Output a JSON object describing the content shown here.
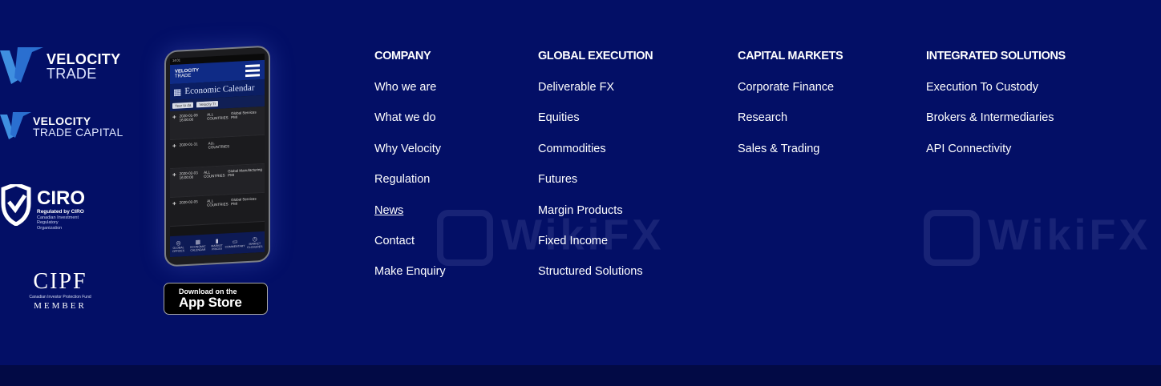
{
  "brand": {
    "velocity_trade": {
      "line1": "VELOCITY",
      "line2": "TRADE"
    },
    "velocity_trade_capital": {
      "line1": "VELOCITY",
      "line2": "TRADE CAPITAL"
    },
    "ciro": {
      "name": "CIRO",
      "regulated": "Regulated by CIRO",
      "org_line1": "Canadian Investment",
      "org_line2": "Regulatory",
      "org_line3": "Organization"
    },
    "cipf": {
      "title": "CIPF",
      "subtitle": "Canadian Investor Protection Fund",
      "member": "MEMBER"
    }
  },
  "phone": {
    "status": "14:01",
    "logo_line1": "VELOCITY",
    "logo_line2": "TRADE",
    "screen_title": "Economic Calendar",
    "filter1": "Year to da",
    "filter2": "Velocity Tr",
    "rows": [
      {
        "date": "2020-01-06 16:00:00",
        "country": "ALL COUNTRIES",
        "event": "Global Services PMI"
      },
      {
        "date": "2020-01-31",
        "country": "ALL COUNTRIES",
        "event": ""
      },
      {
        "date": "2020-02-03 16:00:00",
        "country": "ALL COUNTRIES",
        "event": "Global Manufacturing PMI"
      },
      {
        "date": "2020-02-05",
        "country": "ALL COUNTRIES",
        "event": "Global Services PMI"
      }
    ],
    "nav": [
      "GLOBAL OFFICES",
      "ECONOMIC CALENDAR",
      "MARKET PRICES",
      "COMMENTARY",
      "MARKET CLOSURES"
    ]
  },
  "appstore": {
    "small": "Download on the",
    "big": "App Store"
  },
  "columns": [
    {
      "heading": "COMPANY",
      "links": [
        "Who we are",
        "What we do",
        "Why Velocity",
        "Regulation",
        "News",
        "Contact",
        "Make Enquiry"
      ]
    },
    {
      "heading": "GLOBAL EXECUTION",
      "links": [
        "Deliverable FX",
        "Equities",
        "Commodities",
        "Futures",
        "Margin Products",
        "Fixed Income",
        "Structured Solutions"
      ]
    },
    {
      "heading": "CAPITAL MARKETS",
      "links": [
        "Corporate Finance",
        "Research",
        "Sales & Trading"
      ]
    },
    {
      "heading": "INTEGRATED SOLUTIONS",
      "links": [
        "Execution To Custody",
        "Brokers & Intermediaries",
        "API Connectivity"
      ]
    }
  ],
  "watermark": "WikiFX",
  "colors": {
    "background": "#030f66",
    "bottom_bar": "#020a45",
    "accent": "#3f8fe0"
  }
}
